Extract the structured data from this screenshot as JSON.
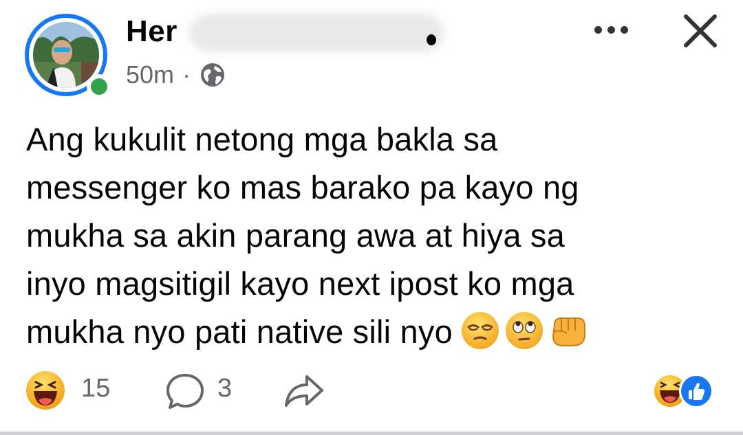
{
  "post": {
    "author": {
      "name_visible": "Her",
      "avatar_icon": "profile-photo",
      "online_status": "online",
      "online_color": "#31a24c",
      "ring_color": "#1877f2"
    },
    "timestamp": "50m",
    "separator": "·",
    "audience_icon": "globe-icon",
    "menu_icon": "more-dots-icon",
    "close_icon": "close-icon",
    "text_lines": [
      "Ang kukulit netong mga bakla sa",
      "messenger ko mas barako pa kayo ng",
      "mukha sa akin parang awa at hiya sa",
      "inyo magsitigil kayo next ipost ko mga",
      "mukha nyo pati native sili nyo"
    ],
    "emojis": [
      "relieved-face-emoji",
      "eye-roll-emoji",
      "fist-bump-emoji"
    ]
  },
  "footer": {
    "reaction_icon": "haha-icon",
    "reaction_count": "15",
    "comment_icon": "comment-icon",
    "comment_count": "3",
    "share_icon": "share-icon",
    "summary_icons": [
      "haha-icon",
      "like-icon"
    ],
    "like_color": "#1877f2"
  }
}
